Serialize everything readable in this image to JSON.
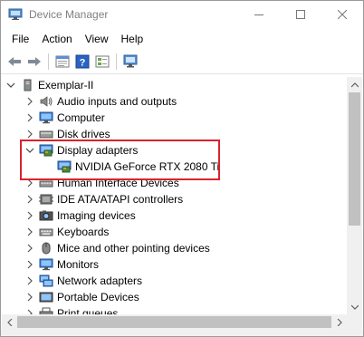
{
  "window": {
    "title": "Device Manager"
  },
  "menu": {
    "items": [
      "File",
      "Action",
      "View",
      "Help"
    ]
  },
  "toolbar": {
    "buttons": [
      "back-icon",
      "forward-icon",
      "properties-icon",
      "help-icon",
      "details-icon",
      "scan-hardware-icon"
    ]
  },
  "tree": {
    "root": "Exemplar-II",
    "categories": [
      {
        "label": "Audio inputs and outputs",
        "icon": "audio-icon",
        "expanded": false
      },
      {
        "label": "Computer",
        "icon": "computer-icon",
        "expanded": false
      },
      {
        "label": "Disk drives",
        "icon": "disk-icon",
        "expanded": false
      },
      {
        "label": "Display adapters",
        "icon": "display-adapter-icon",
        "expanded": true,
        "children": [
          "NVIDIA GeForce RTX 2080 Ti"
        ]
      },
      {
        "label": "Human Interface Devices",
        "icon": "hid-icon",
        "expanded": false
      },
      {
        "label": "IDE ATA/ATAPI controllers",
        "icon": "ide-icon",
        "expanded": false
      },
      {
        "label": "Imaging devices",
        "icon": "camera-icon",
        "expanded": false
      },
      {
        "label": "Keyboards",
        "icon": "keyboard-icon",
        "expanded": false
      },
      {
        "label": "Mice and other pointing devices",
        "icon": "mouse-icon",
        "expanded": false
      },
      {
        "label": "Monitors",
        "icon": "monitor-icon",
        "expanded": false
      },
      {
        "label": "Network adapters",
        "icon": "network-icon",
        "expanded": false
      },
      {
        "label": "Portable Devices",
        "icon": "portable-icon",
        "expanded": false
      },
      {
        "label": "Print queues",
        "icon": "printer-icon",
        "expanded": false
      }
    ]
  },
  "colors": {
    "highlight_border": "#d9232d",
    "title_text": "#808080",
    "scrollbar_thumb": "#c1c1c1"
  }
}
